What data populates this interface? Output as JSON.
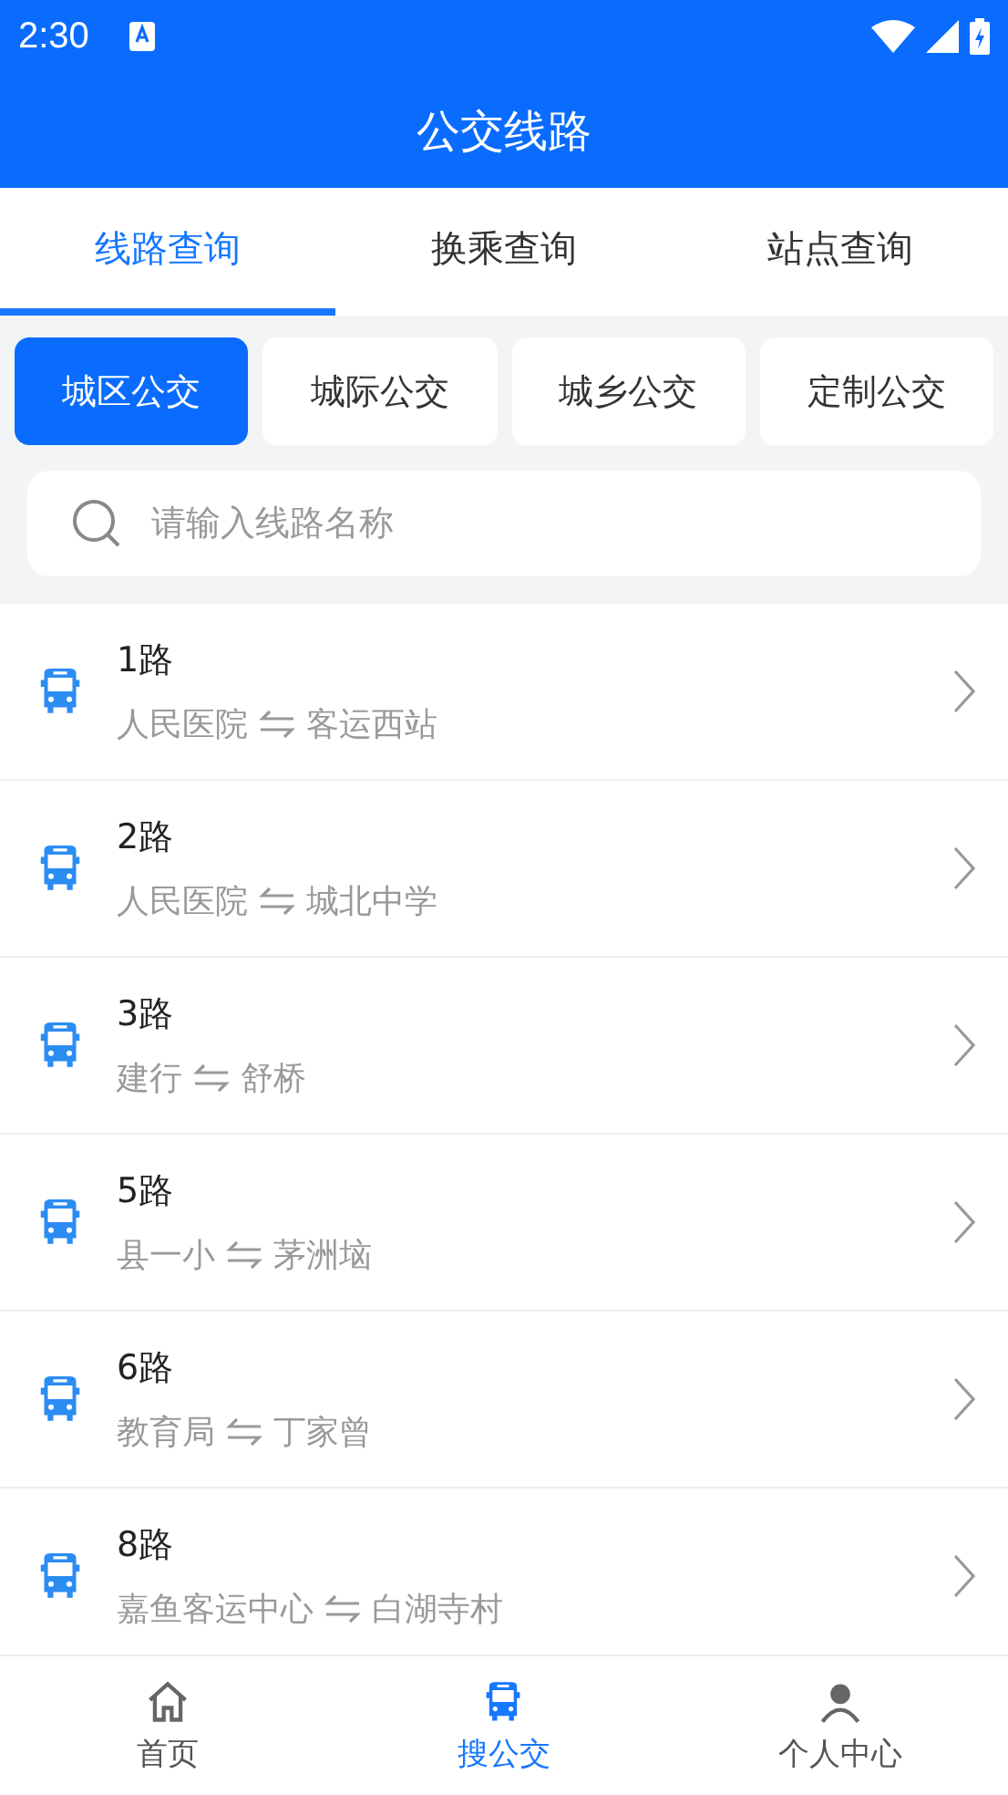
{
  "status_bar": {
    "time": "2:30"
  },
  "title": "公交线路",
  "tabs": [
    {
      "label": "线路查询",
      "selected": true
    },
    {
      "label": "换乘查询",
      "selected": false
    },
    {
      "label": "站点查询",
      "selected": false
    }
  ],
  "categories": [
    {
      "label": "城区公交",
      "selected": true
    },
    {
      "label": "城际公交",
      "selected": false
    },
    {
      "label": "城乡公交",
      "selected": false
    },
    {
      "label": "定制公交",
      "selected": false
    }
  ],
  "search": {
    "placeholder": "请输入线路名称"
  },
  "routes": [
    {
      "name": "1路",
      "from": "人民医院",
      "to": "客运西站"
    },
    {
      "name": "2路",
      "from": "人民医院",
      "to": "城北中学"
    },
    {
      "name": "3路",
      "from": "建行",
      "to": "舒桥"
    },
    {
      "name": "5路",
      "from": "县一小",
      "to": "茅洲垴"
    },
    {
      "name": "6路",
      "from": "教育局",
      "to": "丁家曾"
    },
    {
      "name": "8路",
      "from": "嘉鱼客运中心",
      "to": "白湖寺村"
    }
  ],
  "bottom_nav": [
    {
      "label": "首页",
      "kind": "home",
      "selected": false
    },
    {
      "label": "搜公交",
      "kind": "bus",
      "selected": true
    },
    {
      "label": "个人中心",
      "kind": "person",
      "selected": false
    }
  ]
}
